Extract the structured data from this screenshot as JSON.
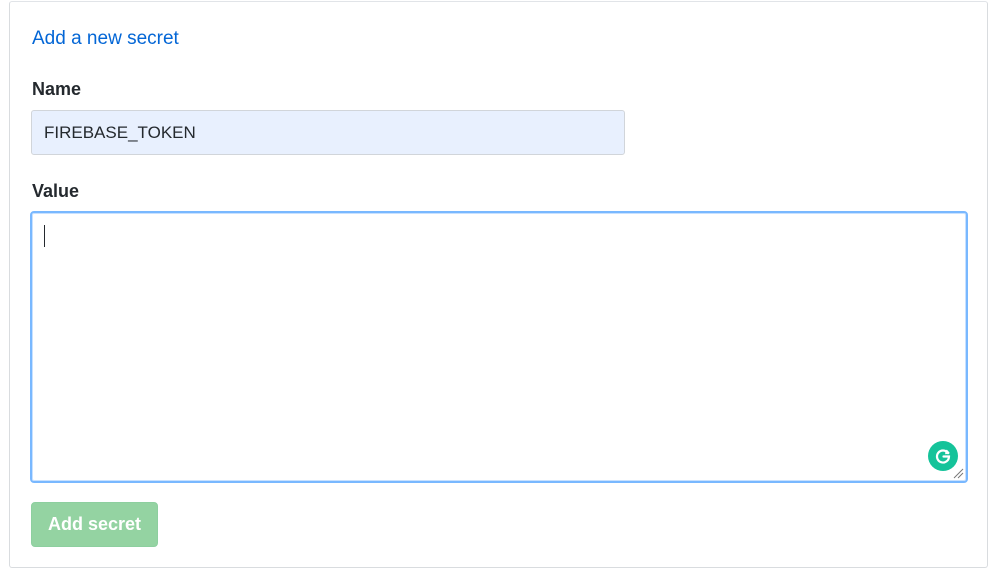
{
  "form": {
    "add_link": "Add a new secret",
    "name_label": "Name",
    "name_value": "FIREBASE_TOKEN",
    "value_label": "Value",
    "value_text": "",
    "submit_label": "Add secret",
    "submit_disabled": true
  },
  "icons": {
    "grammarly": "grammarly-icon",
    "resize": "resize-grip-icon"
  },
  "colors": {
    "link": "#0366d6",
    "focus_border": "#79b8ff",
    "autofill_bg": "#e8f0fe",
    "button_disabled_bg": "#94d3a2",
    "grammarly": "#15c39a"
  }
}
